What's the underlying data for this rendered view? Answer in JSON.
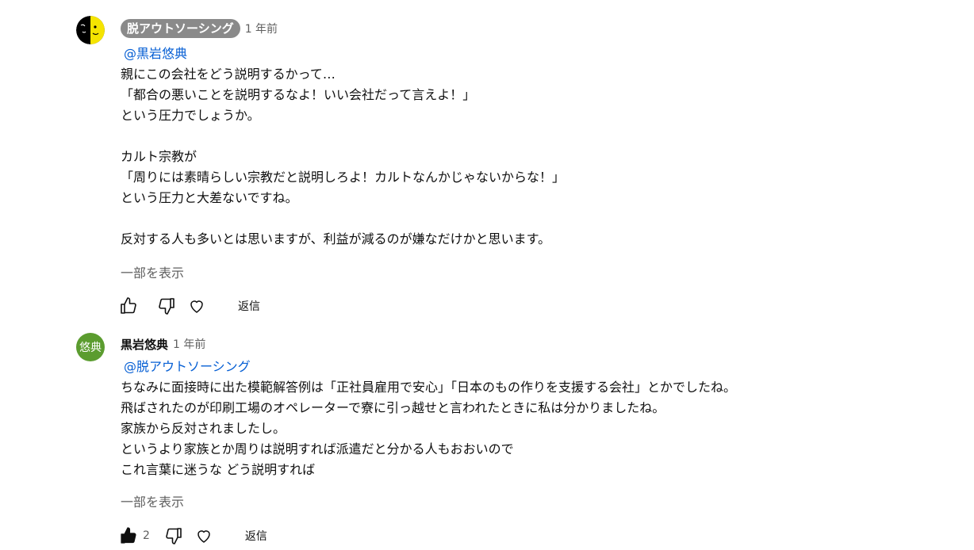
{
  "comments": [
    {
      "author": "脱アウトソーシング",
      "time": "1 年前",
      "mention": "@黒岩悠典",
      "lines": [
        "親にこの会社をどう説明するかって…",
        "「都合の悪いことを説明するなよ！いい会社だって言えよ！」",
        "という圧力でしょうか。",
        "",
        "カルト宗教が",
        "「周りには素晴らしい宗教だと説明しろよ！カルトなんかじゃないからな！」",
        "という圧力と大差ないですね。",
        "",
        "反対する人も多いとは思いますが、利益が減るのが嫌なだけかと思います。"
      ],
      "show_more": "一部を表示",
      "reply": "返信",
      "like_count": "",
      "liked": false
    },
    {
      "author": "黒岩悠典",
      "avatar_text": "悠典",
      "avatar_color": "#5b9c2f",
      "time": "1 年前",
      "mention": "@脱アウトソーシング",
      "lines": [
        "ちなみに面接時に出た模範解答例は「正社員雇用で安心」「日本のもの作りを支援する会社」とかでしたね。",
        "飛ばされたのが印刷工場のオペレーターで寮に引っ越せと言われたときに私は分かりましたね。",
        "家族から反対されましたし。",
        "というより家族とか周りは説明すれば派遣だと分かる人もおおいので",
        "これ言葉に迷うな どう説明すれば"
      ],
      "show_more": "一部を表示",
      "reply": "返信",
      "like_count": "2",
      "liked": true
    }
  ],
  "icons": {
    "like": "thumbs-up-icon",
    "dislike": "thumbs-down-icon",
    "heart": "heart-icon"
  }
}
